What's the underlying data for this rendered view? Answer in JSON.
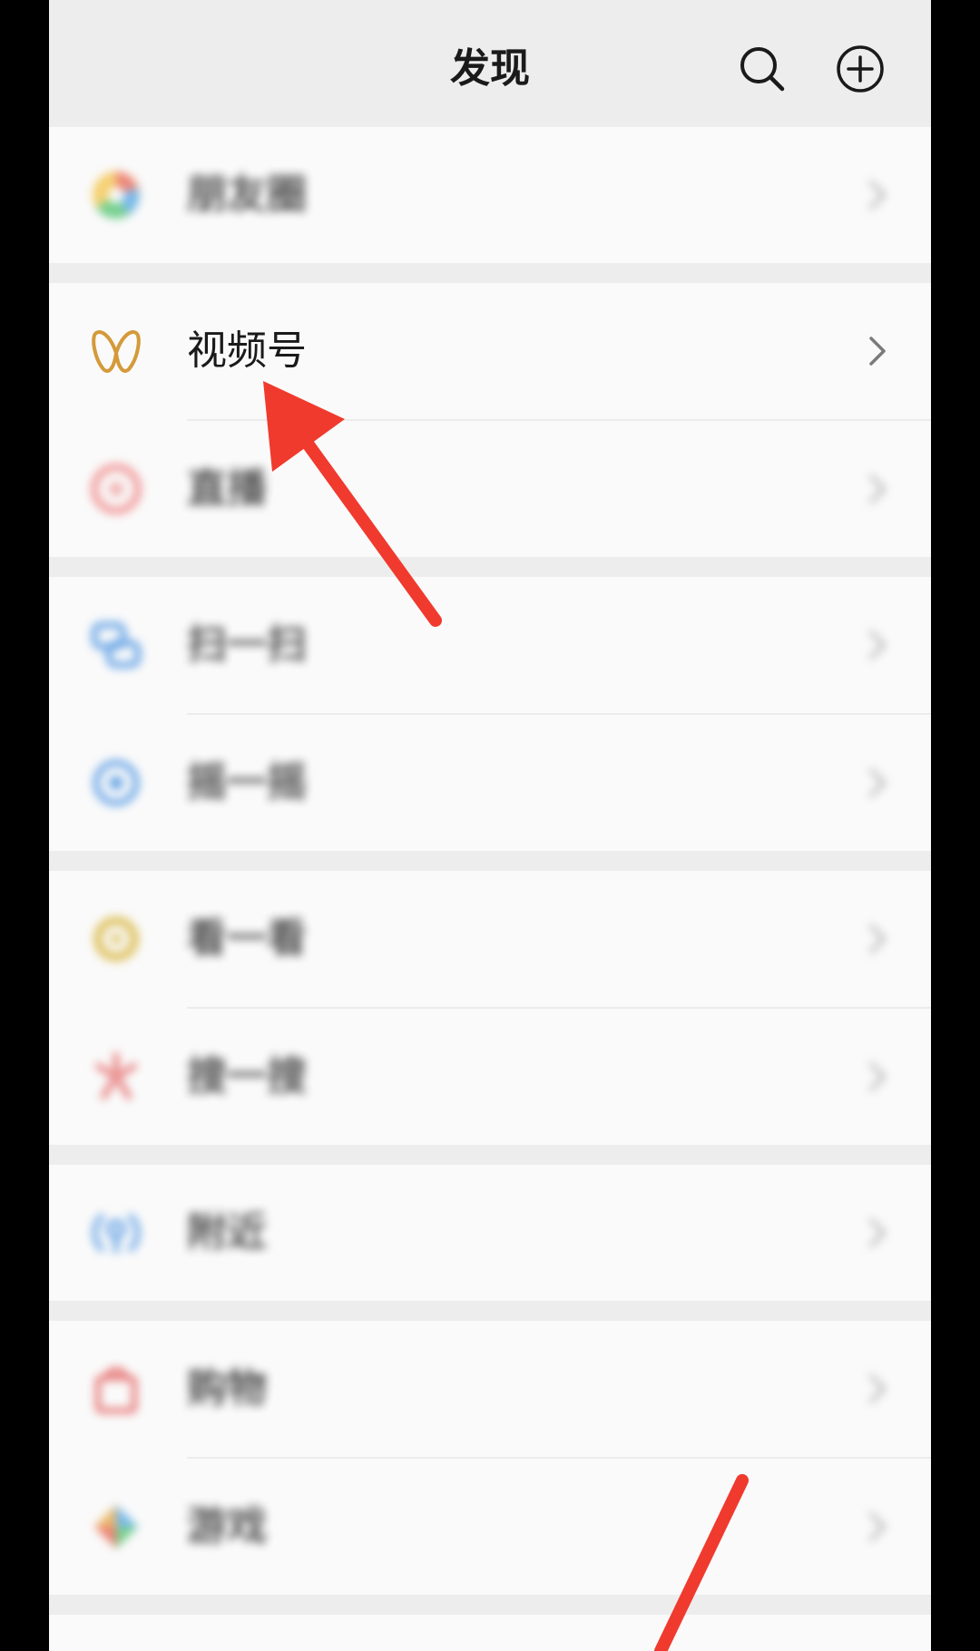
{
  "header": {
    "title": "发现",
    "search_icon": "search-icon",
    "add_icon": "plus-circle-icon"
  },
  "menu": {
    "items": [
      {
        "label": "朋友圈",
        "icon": "moments-icon",
        "blurred": true
      },
      {
        "label": "视频号",
        "icon": "channels-icon",
        "blurred": false
      },
      {
        "label": "直播",
        "icon": "live-icon",
        "blurred": true
      },
      {
        "label": "扫一扫",
        "icon": "scan-icon",
        "blurred": true
      },
      {
        "label": "摇一摇",
        "icon": "shake-icon",
        "blurred": true
      },
      {
        "label": "看一看",
        "icon": "top-stories-icon",
        "blurred": true
      },
      {
        "label": "搜一搜",
        "icon": "search-star-icon",
        "blurred": true
      },
      {
        "label": "附近",
        "icon": "nearby-icon",
        "blurred": true
      },
      {
        "label": "购物",
        "icon": "shopping-bag-icon",
        "blurred": true
      },
      {
        "label": "游戏",
        "icon": "games-icon",
        "blurred": true
      }
    ]
  },
  "colors": {
    "background": "#ededed",
    "row_background": "#fafafa",
    "text": "#1a1a1a",
    "channels_icon": "#d49a3a",
    "annotation_arrow": "#f03a2e"
  }
}
